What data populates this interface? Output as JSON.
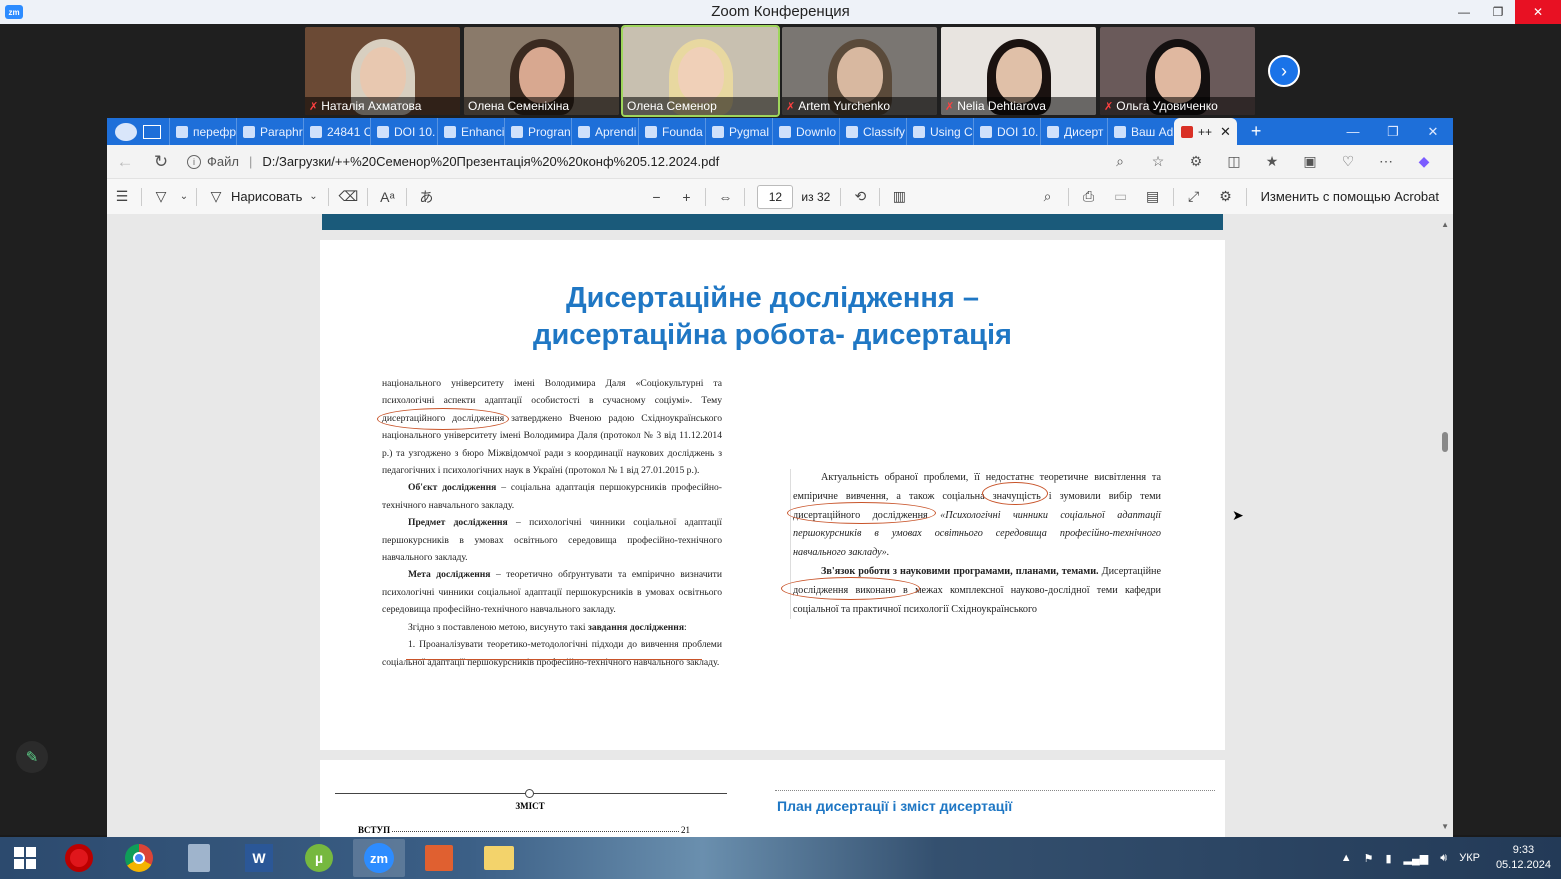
{
  "zoom": {
    "title": "Zoom Конференция",
    "logo": "zm",
    "controls": {
      "minimize": "—",
      "maximize": "❐",
      "close": "✕"
    },
    "participants": [
      {
        "name": "Наталія Ахматова",
        "muted": true,
        "skin": "#e8c8b0",
        "hair": "#d8cfc0",
        "bg": "#6b4a35"
      },
      {
        "name": "Олена Семеніхіна",
        "muted": false,
        "skin": "#d8a890",
        "hair": "#3a2a20",
        "bg": "#8a7a6a"
      },
      {
        "name": "Олена Семенор",
        "muted": false,
        "skin": "#f0d0b8",
        "hair": "#e8d8a0",
        "bg": "#c8c0b0",
        "active": true
      },
      {
        "name": "Artem Yurchenko",
        "muted": true,
        "skin": "#d8b8a0",
        "hair": "#5a4a3a",
        "bg": "#7a7672"
      },
      {
        "name": "Nelia Dehtiarova",
        "muted": true,
        "skin": "#e0c0a8",
        "hair": "#1a1210",
        "bg": "#e8e4e0"
      },
      {
        "name": "Ольга Удовиченко",
        "muted": true,
        "skin": "#e0b8a0",
        "hair": "#141010",
        "bg": "#6a5a5a"
      }
    ],
    "next_arrow": "›",
    "pen_icon": "✎"
  },
  "browser": {
    "tabs": [
      {
        "label": "перефр"
      },
      {
        "label": "Paraphr"
      },
      {
        "label": "24841 C"
      },
      {
        "label": "DOI 10."
      },
      {
        "label": "Enhanci"
      },
      {
        "label": "Progran"
      },
      {
        "label": "Aprendi"
      },
      {
        "label": "Founda"
      },
      {
        "label": "Pygmal"
      },
      {
        "label": "Downlo"
      },
      {
        "label": "Classify"
      },
      {
        "label": "Using C"
      },
      {
        "label": "DOI 10."
      },
      {
        "label": "Дисерт"
      },
      {
        "label": "Ваш Ad"
      },
      {
        "label": "++",
        "selected": true
      }
    ],
    "new_tab": "+",
    "window_controls": {
      "minimize": "—",
      "restore": "❐",
      "close": "✕"
    },
    "address": {
      "scheme": "Файл",
      "separator": "|",
      "url": "D:/Загрузки/++%20Семенор%20Презентація%20%20конф%205.12.2024.pdf"
    },
    "pdf_toolbar": {
      "draw_label": "Нарисовать",
      "current_page": "12",
      "page_total": "из 32",
      "edit_with_acrobat": "Изменить с помощью Acrobat",
      "zoom_out": "−",
      "zoom_in": "+"
    }
  },
  "pdf_page": {
    "title_line1": "Дисертаційне дослідження –",
    "title_line2": "дисертаційна робота- дисертація",
    "left_paragraphs": [
      {
        "indent": false,
        "html": "національного університету імені Володимира Даля «Соціокультурні та психологічні аспекти адаптації особистості в сучасному соціумі». Тему дисертаційного дослідження затверджено Вченою радою Східноукраїнського національного університету імені Володимира Даля (протокол № 3 від 11.12.2014 р.) та узгоджено з бюро Міжвідомчої ради з координації наукових досліджень з педагогічних і психологічних наук в Україні (протокол № 1 від 27.01.2015 р.)."
      },
      {
        "indent": true,
        "bold": "Об'єкт дослідження",
        "html": " – соціальна адаптація першокурсників професійно-технічного навчального закладу."
      },
      {
        "indent": true,
        "bold": "Предмет дослідження",
        "html": " – психологічні чинники соціальної адаптації першокурсників в умовах освітнього середовища професійно-технічного навчального закладу."
      },
      {
        "indent": true,
        "bold": "Мета дослідження",
        "html": " – теоретично обґрунтувати та емпірично визначити психологічні чинники соціальної адаптації першокурсників в умовах освітнього середовища професійно-технічного навчального закладу."
      },
      {
        "indent": true,
        "html": "Згідно з поставленою метою, висунуто такі ",
        "bold_tail": "завдання дослідження",
        "tail": ":"
      },
      {
        "indent": true,
        "html": "1. Проаналізувати теоретико-методологічні підходи до вивчення проблеми соціальної адаптації першокурсників професійно-технічного навчального закладу."
      }
    ],
    "right_p1_plain": "Актуальність обраної проблеми, її недостатнє теоретичне висвітлення та емпіричне вивчення, а також соціальна значущість і зумовили вибір теми дисертаційного дослідження ",
    "right_p1_italic": "«Психологічні чинники соціальної адаптації першокурсників в умовах освітнього середовища професійно-технічного навчального закладу».",
    "right_p2_bold": "Зв'язок роботи з науковими програмами, планами, темами.",
    "right_p2_plain": " Дисертаційне дослідження виконано в межах комплексної науково-дослідної теми кафедри соціальної та практичної психології Східноукраїнського"
  },
  "next_page": {
    "toc_title": "ЗМІСТ",
    "toc_entry": "ВСТУП",
    "toc_page": "21",
    "plan_title": "План дисертації і зміст дисертації"
  },
  "taskbar": {
    "apps": [
      "opera",
      "chrome",
      "calculator",
      "word",
      "utorrent",
      "zoom",
      "presentation",
      "explorer"
    ],
    "zoom_label": "zm",
    "word_label": "W",
    "lang": "УКР",
    "time": "9:33",
    "date": "05.12.2024"
  }
}
